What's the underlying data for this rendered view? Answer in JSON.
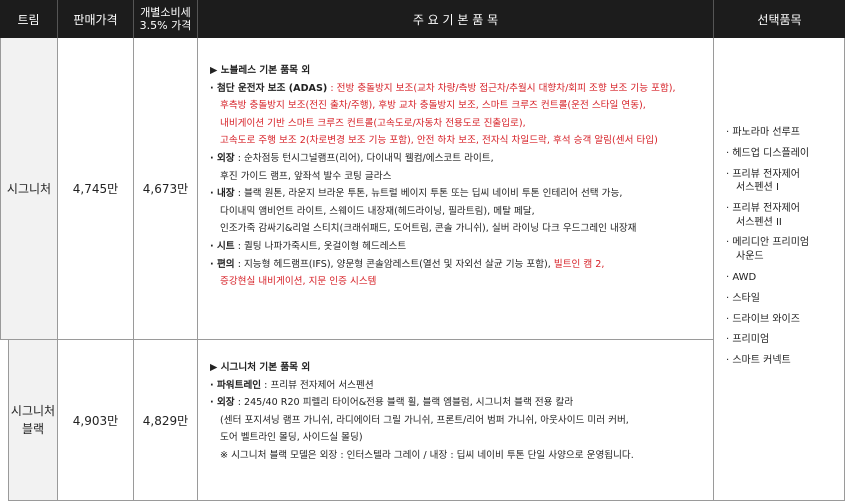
{
  "headers": {
    "trim": "트림",
    "price": "판매가격",
    "tax_price_line1": "개별소비세",
    "tax_price_line2": "3.5% 가격",
    "features": "주 요 기 본 품 목",
    "options": "선택품목"
  },
  "rows": [
    {
      "trim": "시그니처",
      "price": "4,745만",
      "tax_price": "4,673만",
      "block_title": "▶ 노블레스 기본 품목 외",
      "adas_label": "· 첨단 운전자 보조 (ADAS)",
      "adas_lines": [
        " : 전방 충돌방지 보조(교차 차량/측방 접근차/추월시 대향차/회피 조향 보조 기능 포함),",
        "후측방 충돌방지 보조(전진 출차/주행), 후방 교차 충돌방지 보조, 스마트 크루즈 컨트롤(운전 스타일 연동),",
        "내비게이션 기반 스마트 크루즈 컨트롤(고속도로/자동차 전용도로 진출입로),",
        "고속도로 주행 보조 2(차로변경 보조 기능 포함), 안전 하차 보조, 전자식 차일드락, 후석 승객 알림(센서 타입)"
      ],
      "exterior_label": "· 외장",
      "exterior_lines": [
        " : 순차점등 턴시그널램프(리어), 다이내믹 웰컴/에스코트 라이트,",
        "후진 가이드 램프, 앞좌석 발수 코팅 글라스"
      ],
      "interior_label": "· 내장",
      "interior_lines": [
        " : 블랙 원톤, 라운지 브라운 투톤, 뉴트럴 베이지 투톤 또는 딥씨 네이비 투톤 인테리어 선택 가능,",
        "다이내믹 앰비언트 라이트, 스웨이드 내장재(헤드라이닝, 필라트림), 메탈 페달,",
        "인조가죽 감싸기&리얼 스티치(크래쉬패드, 도어트림, 콘솔 가니쉬), 실버 라이닝 다크 우드그레인 내장재"
      ],
      "seat_label": "· 시트",
      "seat_line": " : 퀼팅 나파가죽시트, 옷걸이형 헤드레스트",
      "conv_label": "· 편의",
      "conv_line1_black": " : 지능형 헤드램프(IFS), 양문형 콘솔암레스트(열선 및 자외선 살균 기능 포함), ",
      "conv_line1_red": "빌트인 캠 2,",
      "conv_line2": "증강현실 내비게이션, 지문 인증 시스템"
    },
    {
      "trim_line1": "시그니처",
      "trim_line2": "블랙",
      "price": "4,903만",
      "tax_price": "4,829만",
      "block_title": "▶ 시그니처 기본 품목 외",
      "pt_label": "· 파워트레인",
      "pt_line": " : 프리뷰 전자제어 서스펜션",
      "ext_label": "· 외장",
      "ext_lines": [
        " : 245/40 R20 피렐리 타이어&전용 블랙 휠, 블랙 엠블럼, 시그니처 블랙 전용 칼라",
        "(센터 포지셔닝 램프 가니쉬, 라디에이터 그릴 가니쉬, 프론트/리어 범퍼 가니쉬, 아웃사이드 미러 커버,",
        "도어 벨트라인 몰딩, 사이드실 몰딩)",
        "※ 시그니처 블랙 모델은 외장 : 인터스텔라 그레이 / 내장 : 딥씨 네이비 투톤 단일 사양으로 운영됩니다."
      ]
    }
  ],
  "options": [
    [
      "· 파노라마 선루프"
    ],
    [
      "· 헤드업 디스플레이"
    ],
    [
      "· 프리뷰 전자제어",
      "서스펜션 I"
    ],
    [
      "· 프리뷰 전자제어",
      "서스펜션 II"
    ],
    [
      "· 메리디안 프리미엄",
      "사운드"
    ],
    [
      "· AWD"
    ],
    [
      "· 스타일"
    ],
    [
      "· 드라이브 와이즈"
    ],
    [
      "· 프리미엄"
    ],
    [
      "· 스마트 커넥트"
    ]
  ],
  "colors": {
    "header_bg": "#1c1c1c",
    "accent_red": "#d61f26",
    "trim_bg": "#f2f2f2"
  }
}
